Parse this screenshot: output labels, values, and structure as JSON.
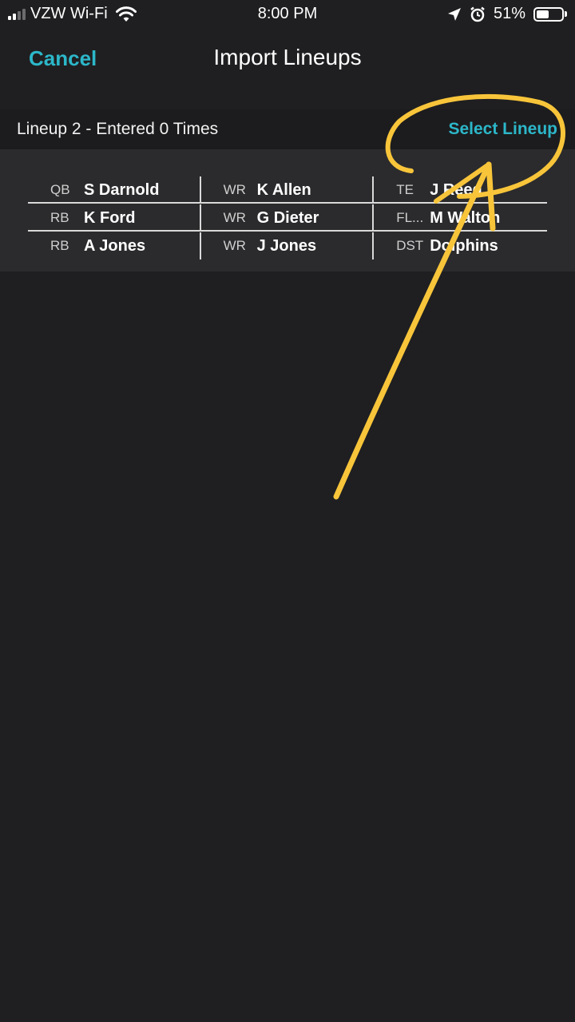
{
  "status_bar": {
    "carrier": "VZW Wi-Fi",
    "time": "8:00 PM",
    "battery": "51%",
    "battery_level": 0.51,
    "icons": [
      "signal-icon",
      "wifi-icon",
      "location-icon",
      "alarm-icon",
      "battery-icon"
    ]
  },
  "nav": {
    "cancel_label": "Cancel",
    "title": "Import Lineups"
  },
  "lineup": {
    "title": "Lineup 2 - Entered 0 Times",
    "select_label": "Select Lineup",
    "rows": [
      [
        {
          "pos": "QB",
          "name": "S Darnold"
        },
        {
          "pos": "WR",
          "name": "K Allen"
        },
        {
          "pos": "TE",
          "name": "J Reed"
        }
      ],
      [
        {
          "pos": "RB",
          "name": "K Ford"
        },
        {
          "pos": "WR",
          "name": "G Dieter"
        },
        {
          "pos": "FL...",
          "name": "M Walton"
        }
      ],
      [
        {
          "pos": "RB",
          "name": "A Jones"
        },
        {
          "pos": "WR",
          "name": "J Jones"
        },
        {
          "pos": "DST",
          "name": "Dolphins"
        }
      ]
    ]
  },
  "colors": {
    "accent": "#2cb7c9",
    "background": "#1f1f21",
    "card": "#2b2b2d",
    "annotation": "#f8c53a"
  }
}
